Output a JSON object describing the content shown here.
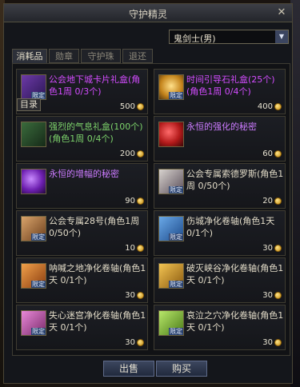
{
  "window": {
    "title": "守护精灵"
  },
  "class_select": {
    "value": "鬼剑士(男)"
  },
  "tabs": [
    {
      "label": "消耗品"
    },
    {
      "label": "勋章"
    },
    {
      "label": "守护珠"
    },
    {
      "label": "退还"
    }
  ],
  "items": [
    {
      "name": "公会地下城卡片礼盒(角色1周 0/3个)",
      "price": "500",
      "name_color": "#d34cff",
      "icon": "purple-card-box-icon",
      "limited": true
    },
    {
      "name": "时间引导石礼盒(25个)(角色1周 0/4个)",
      "price": "400",
      "name_color": "#d34cff",
      "icon": "clock-stone-box-icon",
      "limited": true
    },
    {
      "name": "强烈的气息礼盒(100个)(角色1周 0/4个)",
      "price": "200",
      "name_color": "#7dd36b",
      "icon": "green-aura-box-icon",
      "limited": false
    },
    {
      "name": "永恒的强化的秘密",
      "price": "60",
      "name_color": "#cc7bff",
      "icon": "red-orb-icon",
      "limited": false
    },
    {
      "name": "永恒的增幅的秘密",
      "price": "90",
      "name_color": "#cc7bff",
      "icon": "purple-orb-icon",
      "limited": false
    },
    {
      "name": "公会专属索德罗斯(角色1周 0/50个)",
      "price": "20",
      "name_color": "#e3dcc8",
      "icon": "sodros-icon",
      "limited": true
    },
    {
      "name": "公会专属28号(角色1周 0/50个)",
      "price": "10",
      "name_color": "#e3dcc8",
      "icon": "no28-icon",
      "limited": true
    },
    {
      "name": "伤城净化卷轴(角色1天 0/1个)",
      "price": "30",
      "name_color": "#e3dcc8",
      "icon": "blue-scroll-icon",
      "limited": true
    },
    {
      "name": "呐喊之地净化卷轴(角色1天 0/1个)",
      "price": "30",
      "name_color": "#e3dcc8",
      "icon": "orange-scroll-icon",
      "limited": true
    },
    {
      "name": "破灭峡谷净化卷轴(角色1天 0/1个)",
      "price": "30",
      "name_color": "#e3dcc8",
      "icon": "amber-scroll-icon",
      "limited": true
    },
    {
      "name": "失心迷宫净化卷轴(角色1天 0/1个)",
      "price": "30",
      "name_color": "#e3dcc8",
      "icon": "pink-scroll-icon",
      "limited": true
    },
    {
      "name": "哀泣之穴净化卷轴(角色1天 0/1个)",
      "price": "30",
      "name_color": "#e3dcc8",
      "icon": "lime-scroll-icon",
      "limited": true
    }
  ],
  "labels": {
    "limited": "限定",
    "tooltip": "目录"
  },
  "buttons": {
    "sell": "出售",
    "buy": "购买"
  },
  "colors": {
    "epic_purple": "#d34cff",
    "rare_green": "#7dd36b",
    "normal": "#e3dcc8",
    "limited_tag": "#27406e",
    "gold": "#e8b928"
  }
}
